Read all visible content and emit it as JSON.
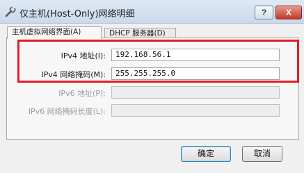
{
  "window": {
    "title": "仅主机(Host-Only)网络明细",
    "help_label": "?",
    "close_label": "X"
  },
  "tabs": [
    {
      "label": "主机虚拟网络界面(A)",
      "active": true
    },
    {
      "label": "DHCP 服务器(D)",
      "active": false
    }
  ],
  "form": {
    "ipv4_address_label": "IPv4 地址(I):",
    "ipv4_address_value": "192.168.56.1",
    "ipv4_mask_label": "IPv4 网络掩码(M):",
    "ipv4_mask_value": "255.255.255.0",
    "ipv6_address_label": "IPv6 地址(P):",
    "ipv6_address_value": "",
    "ipv6_prefix_label": "IPv6 网络掩码长度(L):",
    "ipv6_prefix_value": ""
  },
  "buttons": {
    "ok_label": "确定",
    "cancel_label": "取消"
  },
  "colors": {
    "highlight": "#e11b22",
    "ok_focus": "#3c7fb1"
  }
}
